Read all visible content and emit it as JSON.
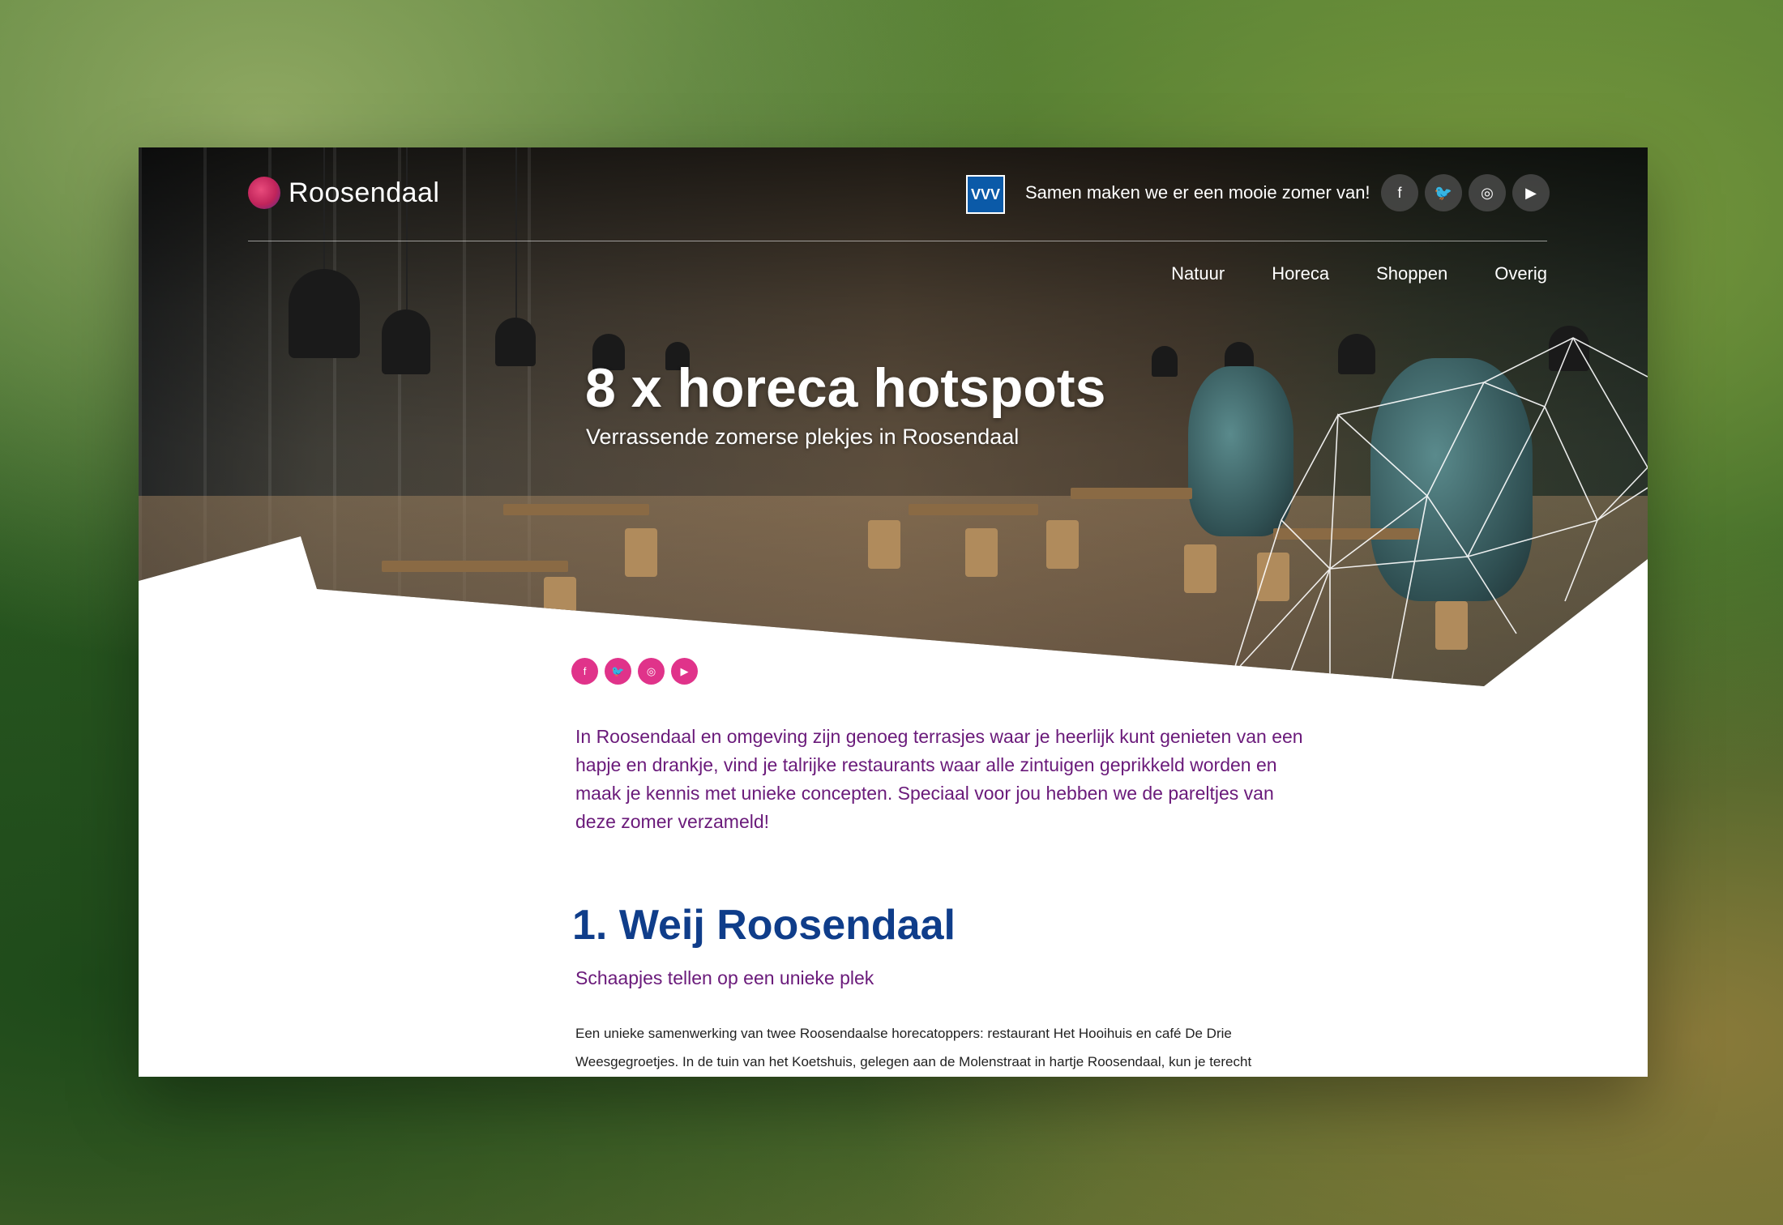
{
  "header": {
    "brand": "Roosendaal",
    "vvv_badge": "VVV",
    "tagline": "Samen maken we er een mooie zomer van!",
    "social": [
      {
        "icon": "facebook-icon",
        "glyph": "f"
      },
      {
        "icon": "twitter-icon",
        "glyph": "🐦"
      },
      {
        "icon": "instagram-icon",
        "glyph": "◎"
      },
      {
        "icon": "youtube-icon",
        "glyph": "▶"
      }
    ],
    "nav": [
      "Natuur",
      "Horeca",
      "Shoppen",
      "Overig"
    ]
  },
  "hero": {
    "title": "8 x horeca hotspots",
    "subtitle": "Verrassende zomerse plekjes in Roosendaal"
  },
  "share": [
    {
      "icon": "facebook-icon",
      "glyph": "f"
    },
    {
      "icon": "twitter-icon",
      "glyph": "🐦"
    },
    {
      "icon": "instagram-icon",
      "glyph": "◎"
    },
    {
      "icon": "youtube-icon",
      "glyph": "▶"
    }
  ],
  "article": {
    "intro": "In Roosendaal en omgeving zijn genoeg terrasjes waar je heerlijk kunt genieten van een hapje en drankje, vind je talrijke restaurants waar alle zintuigen geprikkeld worden en maak je kennis met unieke concepten. Speciaal voor jou hebben we de pareltjes van deze zomer verzameld!",
    "section_title": "1. Weij Roosendaal",
    "section_subtitle": "Schaapjes tellen op een unieke plek",
    "body": "Een unieke samenwerking van twee Roosendaalse horecatoppers: restaurant Het Hooihuis en café De Drie Weesgegroetjes. In de tuin van het Koetshuis, gelegen aan de Molenstraat in hartje Roosendaal, kun je terecht"
  },
  "colors": {
    "accent_pink": "#e0338a",
    "heading_blue": "#0f3d8a",
    "intro_purple": "#6a1a7a"
  }
}
